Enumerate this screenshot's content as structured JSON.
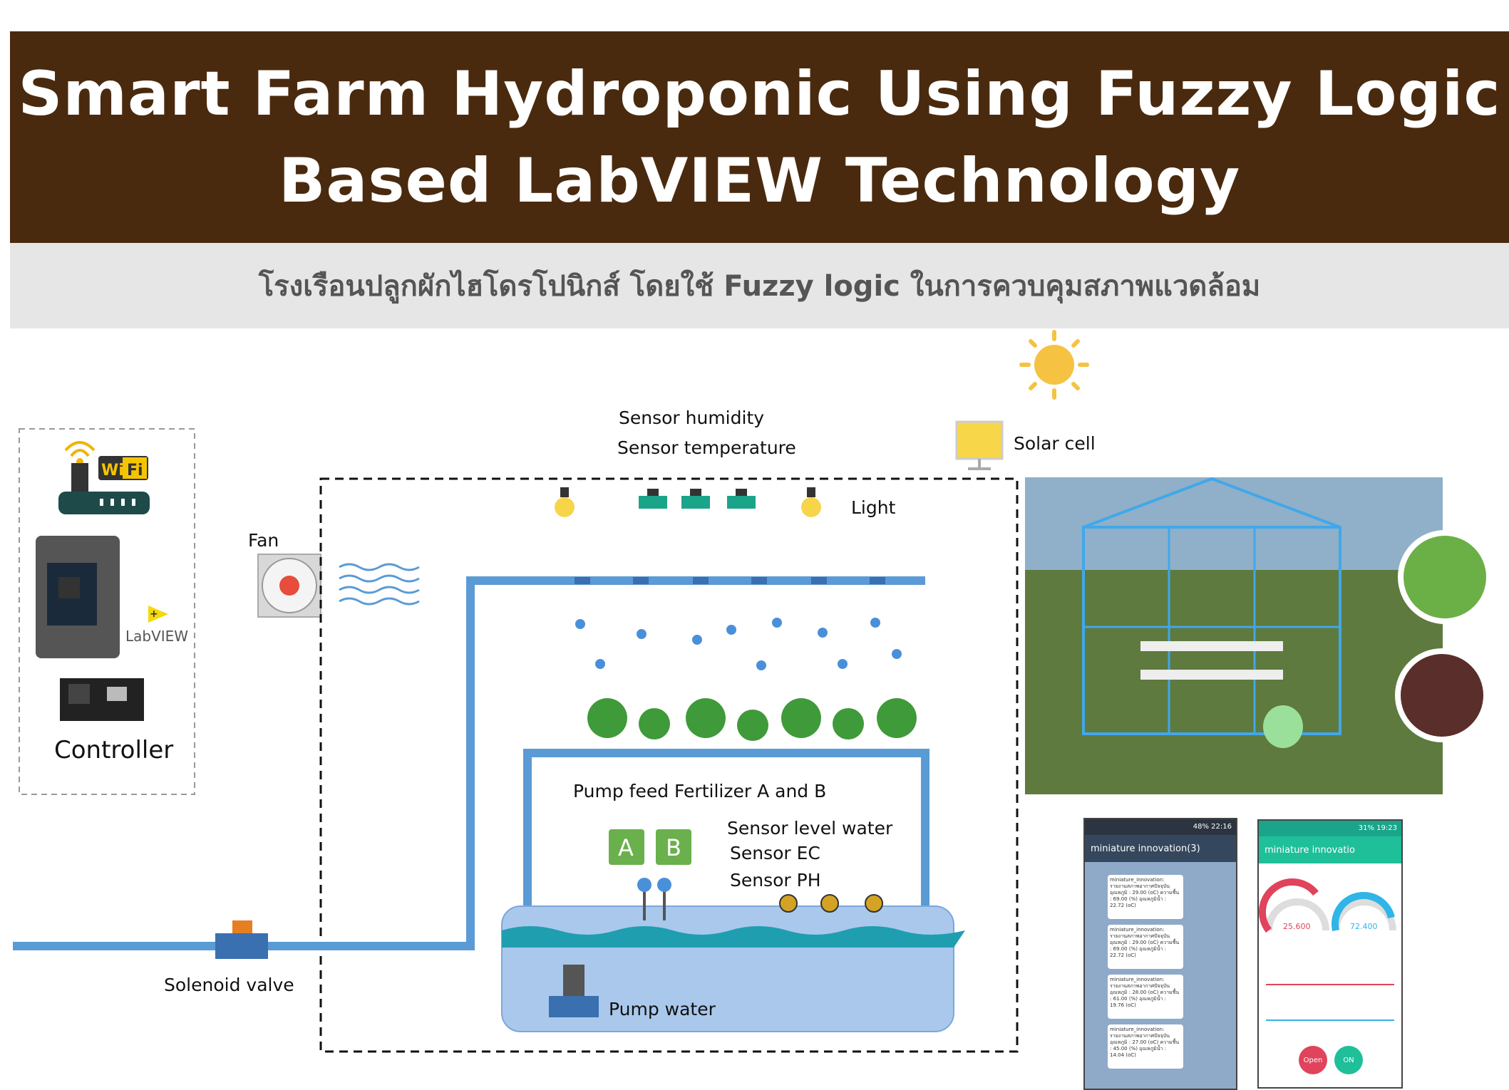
{
  "title": {
    "line1": "Smart Farm Hydroponic Using Fuzzy Logic",
    "line2": "Based LabVIEW Technology"
  },
  "subtitle": "โรงเรือนปลูกผักไฮโดรโปนิกส์ โดยใช้ Fuzzy logic ในการควบคุมสภาพแวดล้อม",
  "labels": {
    "controller": "Controller",
    "labview": "LabVIEW",
    "wifi_a": "Wi",
    "wifi_b": "Fi",
    "fan": "Fan",
    "sensor_humidity": "Sensor humidity",
    "sensor_temperature": "Sensor temperature",
    "solar_cell": "Solar cell",
    "light": "Light",
    "pump_feed": "Pump feed Fertilizer A and B",
    "tank_a": "A",
    "tank_b": "B",
    "sensor_level": "Sensor level water",
    "sensor_ec": "Sensor EC",
    "sensor_ph": "Sensor PH",
    "solenoid_valve": "Solenoid valve",
    "pump_water": "Pump water"
  },
  "phone_line": {
    "header": "miniature innovation(3)",
    "status": "48% 22:16",
    "messages": [
      "miniature_innovation: รายงานสภาพอากาศปัจจุบัน อุณหภูมิ : 29.00 (oC) ความชื้น : 69.00 (%) อุณหภูมิน้ำ : 22.72 (oC)",
      "miniature_innovation: รายงานสภาพอากาศปัจจุบัน อุณหภูมิ : 29.00 (oC) ความชื้น : 69.00 (%) อุณหภูมิน้ำ : 22.72 (oC)",
      "miniature_innovation: รายงานสภาพอากาศปัจจุบัน อุณหภูมิ : 28.00 (oC) ความชื้น : 61.00 (%) อุณหภูมิน้ำ : 19.76 (oC)",
      "miniature_innovation: รายงานสภาพอากาศปัจจุบัน อุณหภูมิ : 27.00 (oC) ความชื้น : 45.00 (%) อุณหภูมิน้ำ : 14.04 (oC)"
    ]
  },
  "phone_app": {
    "header": "miniature innovatio",
    "status": "31% 19:23",
    "gauge_temp": "25.600",
    "gauge_hum": "72.400",
    "btn_open": "Open",
    "btn_on": "ON"
  },
  "colors": {
    "banner": "#4a2a0e",
    "pipe": "#5b9bd5",
    "tank": "#a9c8ec",
    "plant": "#3f9a3a",
    "tank_box": "#6ab04c"
  }
}
